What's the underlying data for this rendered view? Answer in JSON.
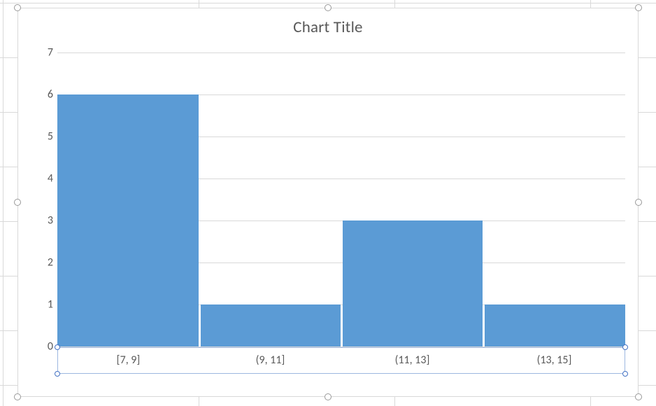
{
  "chart_data": {
    "type": "bar",
    "title": "Chart Title",
    "categories": [
      "[7, 9]",
      "(9, 11]",
      "(11, 13]",
      "(13, 15]"
    ],
    "values": [
      6,
      1,
      3,
      1
    ],
    "xlabel": "",
    "ylabel": "",
    "ylim": [
      0,
      7
    ],
    "y_ticks": [
      0,
      1,
      2,
      3,
      4,
      5,
      6,
      7
    ],
    "bar_color": "#5b9bd5",
    "gap": 0
  }
}
